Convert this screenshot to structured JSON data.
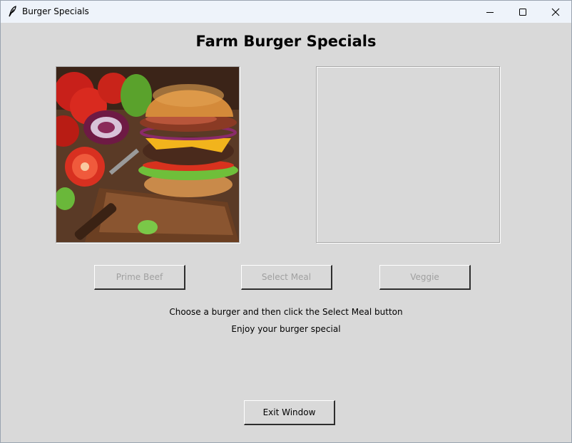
{
  "window": {
    "title": "Burger Specials"
  },
  "header": {
    "title": "Farm Burger Specials"
  },
  "buttons": {
    "prime_beef": "Prime Beef",
    "select_meal": "Select Meal",
    "veggie": "Veggie",
    "exit": "Exit Window"
  },
  "messages": {
    "instruction": "Choose a burger and then click the Select Meal button",
    "enjoy": "Enjoy your burger special"
  },
  "icons": {
    "app": "feather-icon",
    "minimize": "minimize-icon",
    "maximize": "maximize-icon",
    "close": "close-icon"
  },
  "colors": {
    "background": "#d9d9d9",
    "titlebar": "#eef3fa",
    "disabled_text": "#a0a0a0"
  }
}
